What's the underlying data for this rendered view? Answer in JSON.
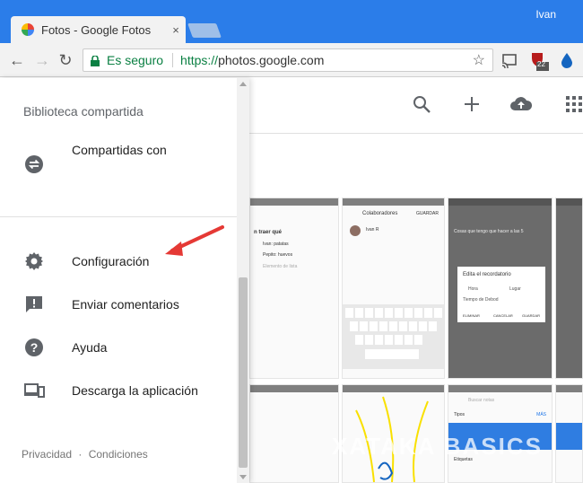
{
  "browser": {
    "tab_title": "Fotos - Google Fotos",
    "tab_close": "×",
    "profile_name": "Ivan",
    "secure_label": "Es seguro",
    "url_scheme": "https://",
    "url_host": "photos.google.com",
    "extension_badge": "22"
  },
  "drawer": {
    "section_title": "Biblioteca compartida",
    "shared_item": "Compartidas con",
    "items": [
      {
        "label": "Configuración",
        "icon": "gear-icon"
      },
      {
        "label": "Enviar comentarios",
        "icon": "feedback-icon"
      },
      {
        "label": "Ayuda",
        "icon": "help-icon"
      },
      {
        "label": "Descarga la aplicación",
        "icon": "devices-icon"
      }
    ],
    "footer": {
      "privacy": "Privacidad",
      "sep": "·",
      "terms": "Condiciones"
    }
  },
  "thumbs": {
    "t2_title": "Colaboradores",
    "t2_action": "GUARDAR",
    "t2_name": "Ivan R",
    "t3_heading": "Cosas que tengo que hacer a las 5",
    "t3_dialog_title": "Edita el recordatorio",
    "t3_hora": "Hora",
    "t3_lugar": "Lugar",
    "t3_debod": "Tiempo de Debod",
    "t3_eliminar": "ELIMINAR",
    "t3_cancelar": "CANCELAR",
    "t3_guardar": "GUARDAR",
    "t1_item1": "Ivan: patatas",
    "t1_item2": "Pepito: huevos",
    "t1_item3": "Elemento de lista",
    "t1_title": "n traer qué",
    "t6_search": "Buscar notas",
    "t6_tipos": "Tipos",
    "t6_mas": "MÁS",
    "t6_etiquetas": "Etiquetas"
  },
  "watermark": "XATAKA BASICS",
  "colors": {
    "titlebar": "#2b7de9",
    "secure_green": "#0b8043",
    "arrow_red": "#e53935"
  }
}
